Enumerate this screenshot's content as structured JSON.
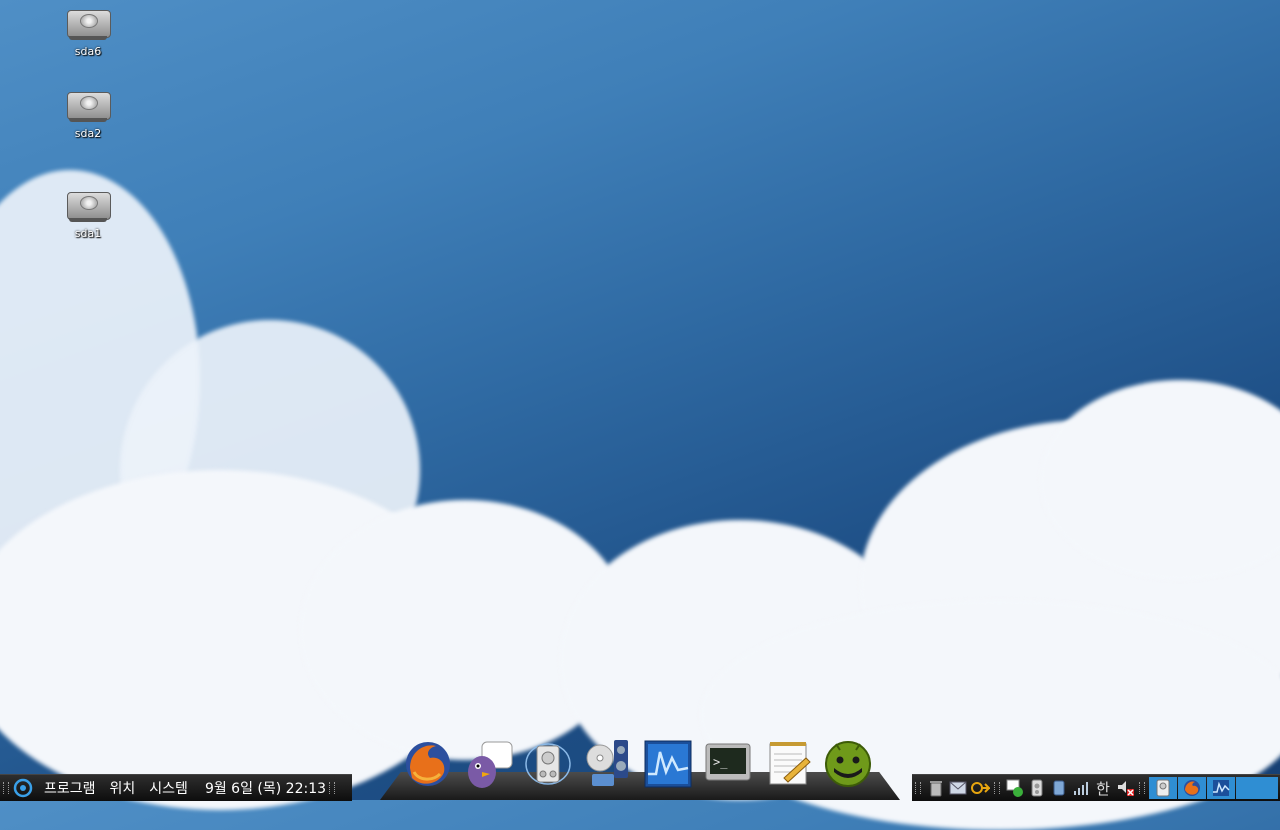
{
  "desktop": {
    "icons": [
      {
        "label": "sda6"
      },
      {
        "label": "sda2"
      },
      {
        "label": "sda1"
      }
    ]
  },
  "menu_panel": {
    "applications": "프로그램",
    "places": "위치",
    "system": "시스템",
    "clock": "9월  6일 (목) 22:13"
  },
  "dock": {
    "items": [
      "firefox-icon",
      "pidgin-icon",
      "disk-utility-icon",
      "media-player-icon",
      "system-monitor-icon",
      "terminal-icon",
      "text-editor-icon",
      "android-icon"
    ]
  },
  "tray": {
    "input_method": "한"
  }
}
